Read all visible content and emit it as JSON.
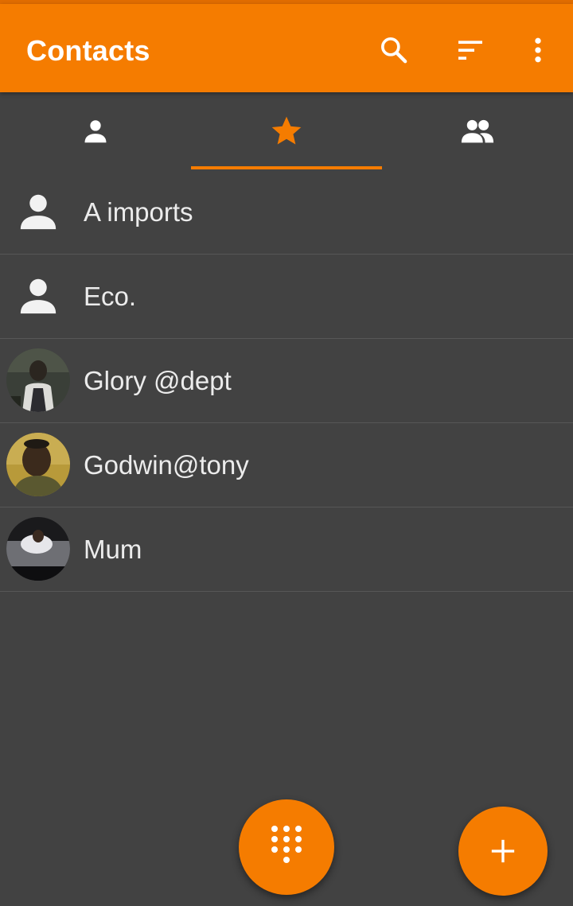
{
  "app": {
    "title": "Contacts",
    "accent_color": "#f57c00",
    "background_color": "#424242"
  },
  "appbar": {
    "actions": [
      {
        "name": "search",
        "icon": "search-icon"
      },
      {
        "name": "sort",
        "icon": "sort-icon"
      },
      {
        "name": "more",
        "icon": "more-vert-icon"
      }
    ]
  },
  "tabs": [
    {
      "name": "contacts",
      "icon": "person-icon",
      "selected": false
    },
    {
      "name": "favorites",
      "icon": "star-icon",
      "selected": true
    },
    {
      "name": "groups",
      "icon": "group-icon",
      "selected": false
    }
  ],
  "contacts": [
    {
      "name": "A imports",
      "avatar": "person-placeholder-icon"
    },
    {
      "name": "Eco.",
      "avatar": "person-placeholder-icon"
    },
    {
      "name": "Glory @dept",
      "avatar": "photo"
    },
    {
      "name": "Godwin@tony",
      "avatar": "photo"
    },
    {
      "name": "Mum",
      "avatar": "photo"
    }
  ],
  "fabs": [
    {
      "name": "dialpad",
      "icon": "dialpad-icon"
    },
    {
      "name": "add-contact",
      "icon": "plus-icon"
    }
  ]
}
